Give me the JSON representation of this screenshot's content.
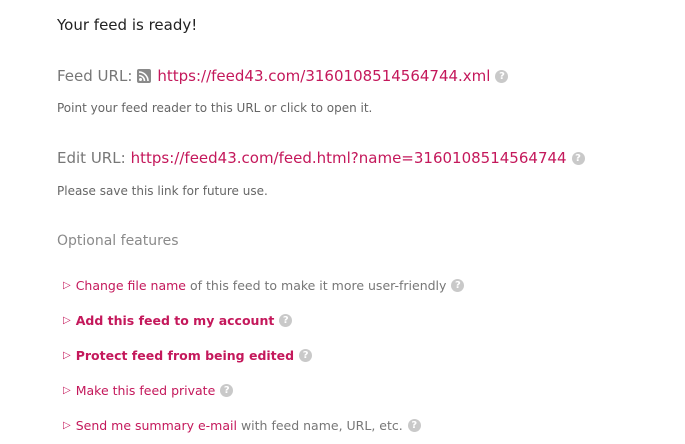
{
  "heading": "Your feed is ready!",
  "feed_url": {
    "label": "Feed URL:",
    "url": "https://feed43.com/3160108514564744.xml",
    "note": "Point your feed reader to this URL or click to open it."
  },
  "edit_url": {
    "label": "Edit URL:",
    "url": "https://feed43.com/feed.html?name=3160108514564744",
    "note": "Please save this link for future use."
  },
  "optional": {
    "title": "Optional features",
    "items": [
      {
        "link": "Change file name",
        "rest": "of this feed to make it more user-friendly"
      },
      {
        "link": "Add this feed to my account",
        "rest": ""
      },
      {
        "link": "Protect feed from being edited",
        "rest": ""
      },
      {
        "link": "Make this feed private",
        "rest": ""
      },
      {
        "link": "Send me summary e-mail",
        "rest": "with feed name, URL, etc."
      }
    ]
  },
  "icons": {
    "triangle": "▷",
    "help": "?",
    "rss": "rss-icon"
  },
  "colors": {
    "link": "#c4185b",
    "muted": "#777777",
    "help_bg": "#c9c9c9"
  }
}
